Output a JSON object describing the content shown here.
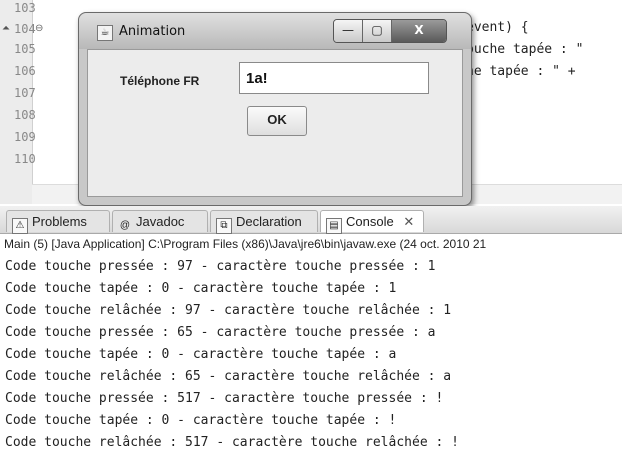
{
  "editor": {
    "line_numbers": [
      "103",
      "104",
      "105",
      "106",
      "107",
      "108",
      "109",
      "110"
    ],
    "code_fragments": {
      "line104": "event) {",
      "line105": "ouche tapée : \"",
      "line106": "he tapée : \" +",
      "line109": "}"
    }
  },
  "dialog": {
    "title": "Animation",
    "window_controls": {
      "minimize": "—",
      "maximize": "▢",
      "close": "X"
    },
    "field_label": "Téléphone FR",
    "field_value": "1a!",
    "ok_label": "OK"
  },
  "panel": {
    "tabs": [
      {
        "label": "Problems",
        "icon": "problems-icon"
      },
      {
        "label": "Javadoc",
        "icon": "at-icon"
      },
      {
        "label": "Declaration",
        "icon": "declaration-icon"
      },
      {
        "label": "Console",
        "icon": "console-icon"
      }
    ],
    "console_path": "Main (5) [Java Application] C:\\Program Files (x86)\\Java\\jre6\\bin\\javaw.exe (24 oct. 2010 21",
    "console_lines": [
      "Code touche pressée : 97 - caractère touche pressée : 1",
      "Code touche tapée : 0 - caractère touche tapée : 1",
      "Code touche relâchée : 97 - caractère touche relâchée : 1",
      "Code touche pressée : 65 - caractère touche pressée : a",
      "Code touche tapée : 0 - caractère touche tapée : a",
      "Code touche relâchée : 65 - caractère touche relâchée : a",
      "Code touche pressée : 517 - caractère touche pressée : !",
      "Code touche tapée : 0 - caractère touche tapée : !",
      "Code touche relâchée : 517 - caractère touche relâchée : !"
    ]
  }
}
